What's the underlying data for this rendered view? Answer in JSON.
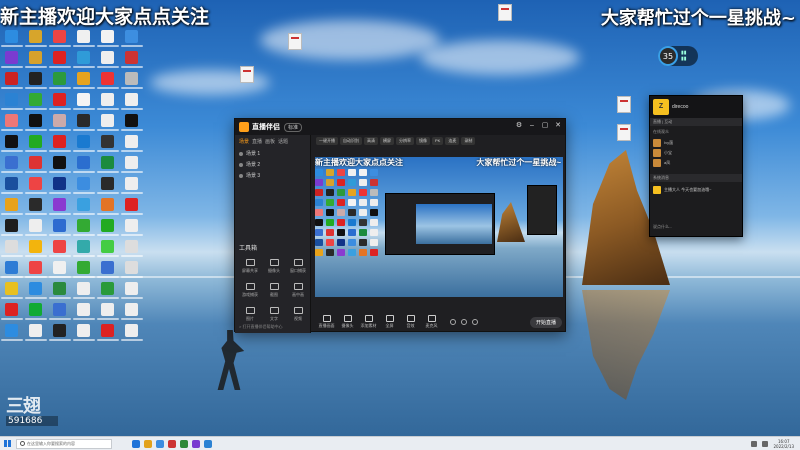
{
  "overlay": {
    "left_text": "新主播欢迎大家点点关注",
    "right_text": "大家帮忙过个一星挑战~"
  },
  "stream_badge": {
    "logo": "三翅",
    "room_number": "591686"
  },
  "perf_widget": {
    "value": "35"
  },
  "desktop_icon_colors": [
    "#2d8ce0",
    "#d7a52b",
    "#e44",
    "#f0f0f0",
    "#f2f2f2",
    "#3d8ee0",
    "#7a3bd0",
    "#d6a12c",
    "#d22",
    "#2f9bd8",
    "#eee",
    "#c33",
    "#c22",
    "#222",
    "#2c9a3c",
    "#e5a320",
    "#e33",
    "#bbb",
    "#2b82d3",
    "#3a3",
    "#d22",
    "#f4f4f4",
    "#eee",
    "#eee",
    "#e77",
    "#111",
    "#caa",
    "#2a2a2a",
    "#eee",
    "#111",
    "#111",
    "#2a2",
    "#d22",
    "#1a7ad0",
    "#333",
    "#eee",
    "#3a6fd0",
    "#d33",
    "#111",
    "#2b6ecf",
    "#1b8b3e",
    "#eee",
    "#1a4f9e",
    "#e44",
    "#138",
    "#3c8de0",
    "#2a2a2a",
    "#eee",
    "#e8a21a",
    "#2a2a2a",
    "#8a3ad0",
    "#3aa0e0",
    "#e37426",
    "#d22",
    "#1d1d1d",
    "#eee",
    "#2d6bd0",
    "#3a3",
    "#2a2",
    "#eee",
    "#ddd",
    "#f3b40d",
    "#e44",
    "#3aa",
    "#4c4",
    "#ddd",
    "#2d7cd5",
    "#e44",
    "#f0f0f0",
    "#3a3",
    "#3a6fd0",
    "#ddd",
    "#e8c020",
    "#2d8ce0",
    "#2b8a3e",
    "#eee",
    "#2a9a3a",
    "#eee",
    "#d22",
    "#1a3",
    "#3a6fd0",
    "#eee",
    "#eee",
    "#eee",
    "#2d8ce0",
    "#eee",
    "#222",
    "#eee",
    "#d22",
    "#eee"
  ],
  "app": {
    "name": "直播伴侣",
    "tag": "标准",
    "side_tabs": [
      "场景",
      "直播",
      "画板",
      "话题"
    ],
    "scenes": [
      "场景 1",
      "场景 2",
      "场景 3"
    ],
    "tools_title": "工具箱",
    "tools": [
      "屏幕共享",
      "摄像头",
      "窗口捕获",
      "游戏捕获",
      "截图",
      "画中画",
      "图片",
      "文字",
      "视频"
    ],
    "side_footer": "> 打开直播伴侣帮助中心",
    "toolbar": [
      "一键开播",
      "自动识别",
      "高清",
      "横屏",
      "分辨率",
      "镜像",
      "PK",
      "连麦",
      "录制"
    ],
    "preview_left_text": "新主播欢迎大家点点关注",
    "preview_right_text": "大家帮忙过个一星挑战~",
    "bottom_items": [
      "直播画面",
      "摄像头",
      "添加素材",
      "全屏",
      "音效",
      "麦克风"
    ],
    "start_label": "开始直播"
  },
  "chat": {
    "avatar_text": "Z",
    "username": "direcoo",
    "subtitle": "直播 | 互动",
    "online_label": "在线观众",
    "messages": [
      "Ivy菌",
      "小宝",
      "a凤"
    ],
    "section_label": "系统消息",
    "notice": "主播大人 今天也要加油哦~",
    "input_placeholder": "说点什么..."
  },
  "taskbar": {
    "search_placeholder": "在这里输入你要搜索的内容",
    "app_colors": [
      "#1e73d8",
      "#e2a21c",
      "#3c8de0",
      "#c33",
      "#2d8a3a",
      "#7a3bd0",
      "#2b82d3"
    ],
    "time": "16:07",
    "date": "2022/2/13"
  }
}
